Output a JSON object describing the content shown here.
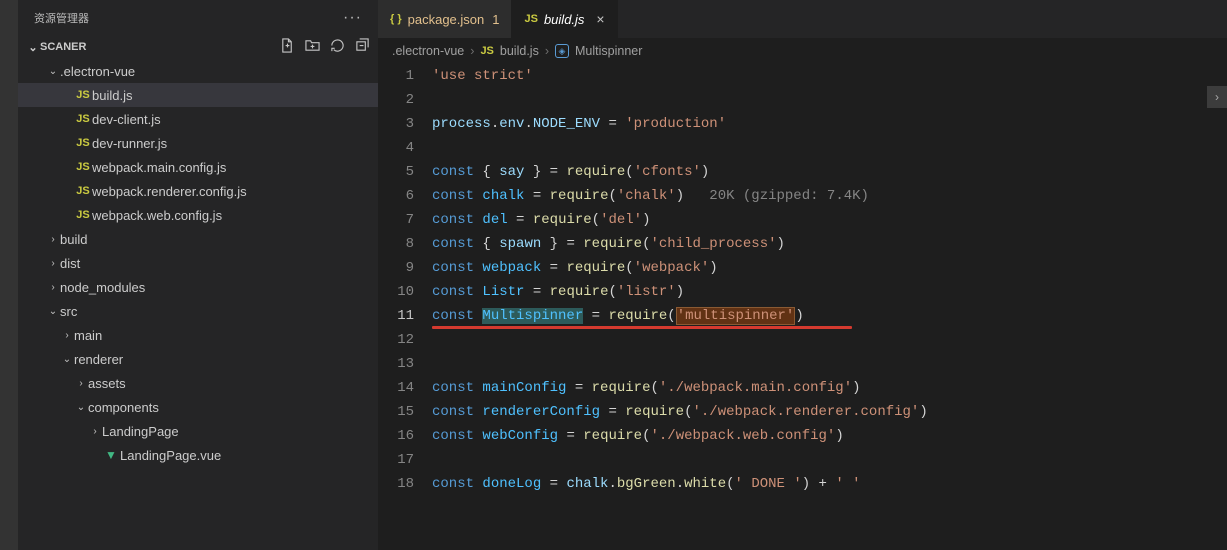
{
  "sidebar": {
    "title": "资源管理器",
    "section": "SCANER",
    "actions": {
      "newfile": "new-file-icon",
      "newfolder": "new-folder-icon",
      "refresh": "refresh-icon",
      "collapse": "collapse-icon"
    },
    "tree": [
      {
        "type": "folder",
        "open": true,
        "depth": 1,
        "name": ".electron-vue"
      },
      {
        "type": "file",
        "depth": 2,
        "icon": "JS",
        "name": "build.js",
        "active": true
      },
      {
        "type": "file",
        "depth": 2,
        "icon": "JS",
        "name": "dev-client.js"
      },
      {
        "type": "file",
        "depth": 2,
        "icon": "JS",
        "name": "dev-runner.js"
      },
      {
        "type": "file",
        "depth": 2,
        "icon": "JS",
        "name": "webpack.main.config.js"
      },
      {
        "type": "file",
        "depth": 2,
        "icon": "JS",
        "name": "webpack.renderer.config.js"
      },
      {
        "type": "file",
        "depth": 2,
        "icon": "JS",
        "name": "webpack.web.config.js"
      },
      {
        "type": "folder",
        "open": false,
        "depth": 1,
        "name": "build"
      },
      {
        "type": "folder",
        "open": false,
        "depth": 1,
        "name": "dist"
      },
      {
        "type": "folder",
        "open": false,
        "depth": 1,
        "name": "node_modules"
      },
      {
        "type": "folder",
        "open": true,
        "depth": 1,
        "name": "src"
      },
      {
        "type": "folder",
        "open": false,
        "depth": 2,
        "name": "main"
      },
      {
        "type": "folder",
        "open": true,
        "depth": 2,
        "name": "renderer"
      },
      {
        "type": "folder",
        "open": false,
        "depth": 3,
        "name": "assets"
      },
      {
        "type": "folder",
        "open": true,
        "depth": 3,
        "name": "components"
      },
      {
        "type": "folder",
        "open": false,
        "depth": 4,
        "name": "LandingPage"
      },
      {
        "type": "file",
        "depth": 4,
        "icon": "V",
        "name": "LandingPage.vue"
      }
    ]
  },
  "tabs": [
    {
      "icon": "{}",
      "name": "package.json",
      "dirty": "1",
      "modified": true,
      "active": false
    },
    {
      "icon": "JS",
      "name": "build.js",
      "italic": true,
      "closable": true,
      "active": true
    }
  ],
  "breadcrumbs": {
    "parts": [
      ".electron-vue",
      "build.js",
      "Multispinner"
    ],
    "file_icon": "JS",
    "symbol_icon": "⊡"
  },
  "editor": {
    "lines": [
      {
        "n": 1,
        "tokens": [
          [
            "str",
            "'use strict'"
          ]
        ]
      },
      {
        "n": 2,
        "tokens": []
      },
      {
        "n": 3,
        "tokens": [
          [
            "var",
            "process"
          ],
          [
            "pun",
            "."
          ],
          [
            "var",
            "env"
          ],
          [
            "pun",
            "."
          ],
          [
            "var",
            "NODE_ENV"
          ],
          [
            "pun",
            " = "
          ],
          [
            "str",
            "'production'"
          ]
        ]
      },
      {
        "n": 4,
        "tokens": []
      },
      {
        "n": 5,
        "tokens": [
          [
            "kw",
            "const"
          ],
          [
            "pun",
            " { "
          ],
          [
            "var",
            "say"
          ],
          [
            "pun",
            " } = "
          ],
          [
            "fn",
            "require"
          ],
          [
            "pun",
            "("
          ],
          [
            "str",
            "'cfonts'"
          ],
          [
            "pun",
            ")"
          ]
        ]
      },
      {
        "n": 6,
        "tokens": [
          [
            "kw",
            "const"
          ],
          [
            "pun",
            " "
          ],
          [
            "const",
            "chalk"
          ],
          [
            "pun",
            " = "
          ],
          [
            "fn",
            "require"
          ],
          [
            "pun",
            "("
          ],
          [
            "str",
            "'chalk'"
          ],
          [
            "pun",
            ")   "
          ],
          [
            "hint",
            "20K (gzipped: 7.4K)"
          ]
        ]
      },
      {
        "n": 7,
        "tokens": [
          [
            "kw",
            "const"
          ],
          [
            "pun",
            " "
          ],
          [
            "const",
            "del"
          ],
          [
            "pun",
            " = "
          ],
          [
            "fn",
            "require"
          ],
          [
            "pun",
            "("
          ],
          [
            "str",
            "'del'"
          ],
          [
            "pun",
            ")"
          ]
        ]
      },
      {
        "n": 8,
        "tokens": [
          [
            "kw",
            "const"
          ],
          [
            "pun",
            " { "
          ],
          [
            "var",
            "spawn"
          ],
          [
            "pun",
            " } = "
          ],
          [
            "fn",
            "require"
          ],
          [
            "pun",
            "("
          ],
          [
            "str",
            "'child_process'"
          ],
          [
            "pun",
            ")"
          ]
        ]
      },
      {
        "n": 9,
        "tokens": [
          [
            "kw",
            "const"
          ],
          [
            "pun",
            " "
          ],
          [
            "const",
            "webpack"
          ],
          [
            "pun",
            " = "
          ],
          [
            "fn",
            "require"
          ],
          [
            "pun",
            "("
          ],
          [
            "str",
            "'webpack'"
          ],
          [
            "pun",
            ")"
          ]
        ]
      },
      {
        "n": 10,
        "tokens": [
          [
            "kw",
            "const"
          ],
          [
            "pun",
            " "
          ],
          [
            "const",
            "Listr"
          ],
          [
            "pun",
            " = "
          ],
          [
            "fn",
            "require"
          ],
          [
            "pun",
            "("
          ],
          [
            "str",
            "'listr'"
          ],
          [
            "pun",
            ")"
          ]
        ]
      },
      {
        "n": 11,
        "current": true,
        "tokens": [
          [
            "kw",
            "const"
          ],
          [
            "pun",
            " "
          ],
          [
            "sel",
            "Multispinner"
          ],
          [
            "pun",
            " = "
          ],
          [
            "fn",
            "require"
          ],
          [
            "pun",
            "("
          ],
          [
            "str-find",
            "'multispinner'"
          ],
          [
            "pun",
            ")"
          ]
        ]
      },
      {
        "n": 12,
        "tokens": []
      },
      {
        "n": 13,
        "tokens": []
      },
      {
        "n": 14,
        "tokens": [
          [
            "kw",
            "const"
          ],
          [
            "pun",
            " "
          ],
          [
            "const",
            "mainConfig"
          ],
          [
            "pun",
            " = "
          ],
          [
            "fn",
            "require"
          ],
          [
            "pun",
            "("
          ],
          [
            "str",
            "'./webpack.main.config'"
          ],
          [
            "pun",
            ")"
          ]
        ]
      },
      {
        "n": 15,
        "tokens": [
          [
            "kw",
            "const"
          ],
          [
            "pun",
            " "
          ],
          [
            "const",
            "rendererConfig"
          ],
          [
            "pun",
            " = "
          ],
          [
            "fn",
            "require"
          ],
          [
            "pun",
            "("
          ],
          [
            "str",
            "'./webpack.renderer.config'"
          ],
          [
            "pun",
            ")"
          ]
        ]
      },
      {
        "n": 16,
        "tokens": [
          [
            "kw",
            "const"
          ],
          [
            "pun",
            " "
          ],
          [
            "const",
            "webConfig"
          ],
          [
            "pun",
            " = "
          ],
          [
            "fn",
            "require"
          ],
          [
            "pun",
            "("
          ],
          [
            "str",
            "'./webpack.web.config'"
          ],
          [
            "pun",
            ")"
          ]
        ]
      },
      {
        "n": 17,
        "tokens": []
      },
      {
        "n": 18,
        "tokens": [
          [
            "kw",
            "const"
          ],
          [
            "pun",
            " "
          ],
          [
            "const",
            "doneLog"
          ],
          [
            "pun",
            " = "
          ],
          [
            "var",
            "chalk"
          ],
          [
            "pun",
            "."
          ],
          [
            "fn",
            "bgGreen"
          ],
          [
            "pun",
            "."
          ],
          [
            "fn",
            "white"
          ],
          [
            "pun",
            "("
          ],
          [
            "str",
            "' DONE '"
          ],
          [
            "pun",
            ") + "
          ],
          [
            "str",
            "' '"
          ]
        ]
      }
    ],
    "underline": {
      "line": 11
    }
  }
}
